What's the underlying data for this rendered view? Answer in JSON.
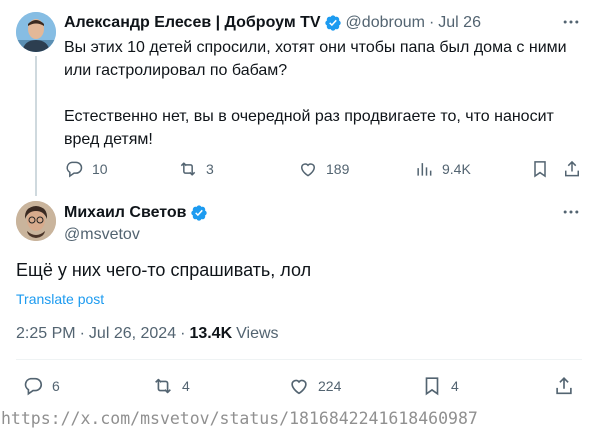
{
  "parent_tweet": {
    "author_name": "Александр Елесев | Доброум TV",
    "handle": "@dobroum",
    "separator": "·",
    "date": "Jul 26",
    "text": "Вы этих 10 детей спросили, хотят они чтобы папа был дома с ними или гастролировал по бабам?\n\nЕстественно нет, вы в очередной раз продвигаете то, что наносит вред детям!",
    "stats": {
      "replies": "10",
      "reposts": "3",
      "likes": "189",
      "views": "9.4K"
    }
  },
  "reply_tweet": {
    "author_name": "Михаил Светов",
    "handle": "@msvetov",
    "text": "Ещё у них чего-то спрашивать, лол",
    "translate_label": "Translate post",
    "time": "2:25 PM",
    "date": "Jul 26, 2024",
    "separator": "·",
    "views_count": "13.4K",
    "views_label": "Views",
    "stats": {
      "replies": "6",
      "reposts": "4",
      "likes": "224",
      "bookmarks": "4"
    }
  },
  "source_url": "https://x.com/msvetov/status/1816842241618460987",
  "colors": {
    "accent": "#1d9bf0",
    "secondary_text": "#536471",
    "primary_text": "#0f1419",
    "verified": "#1d9bf0"
  },
  "icons": [
    "more-icon",
    "reply-icon",
    "repost-icon",
    "like-icon",
    "views-icon",
    "bookmark-icon",
    "share-icon",
    "verified-badge-icon"
  ]
}
